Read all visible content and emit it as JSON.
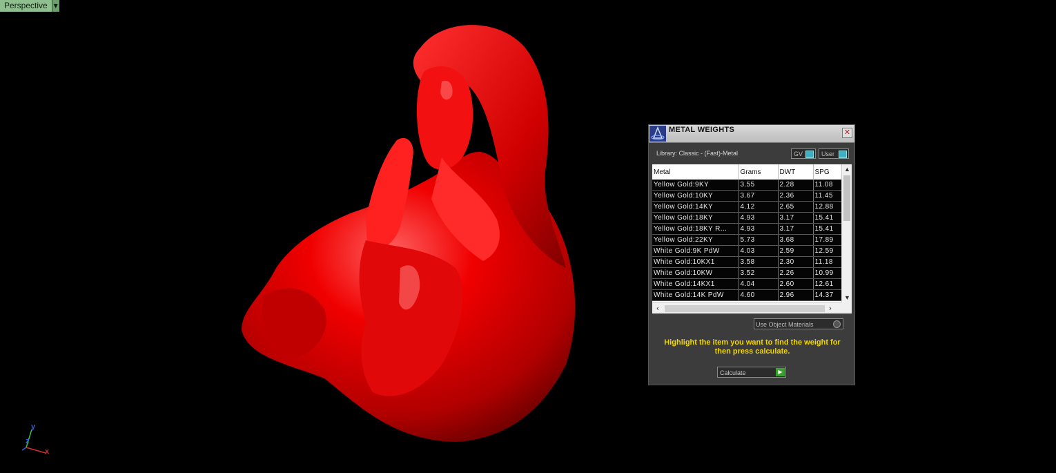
{
  "viewport": {
    "label": "Perspective"
  },
  "axis": {
    "y": "y",
    "z": "z",
    "x": "x"
  },
  "panel": {
    "title": "METAL WEIGHTS",
    "library": "Library: Classic - (Fast)-Metal",
    "toggles": {
      "gv": "GV",
      "user": "User"
    },
    "columns": [
      "Metal",
      "Grams",
      "DWT",
      "SPG"
    ],
    "rows": [
      [
        "Yellow Gold:9KY",
        "3.55",
        "2.28",
        "11.08"
      ],
      [
        "Yellow Gold:10KY",
        "3.67",
        "2.36",
        "11.45"
      ],
      [
        "Yellow Gold:14KY",
        "4.12",
        "2.65",
        "12.88"
      ],
      [
        "Yellow Gold:18KY",
        "4.93",
        "3.17",
        "15.41"
      ],
      [
        "Yellow Gold:18KY R...",
        "4.93",
        "3.17",
        "15.41"
      ],
      [
        "Yellow Gold:22KY",
        "5.73",
        "3.68",
        "17.89"
      ],
      [
        "White Gold:9K PdW",
        "4.03",
        "2.59",
        "12.59"
      ],
      [
        "White Gold:10KX1",
        "3.58",
        "2.30",
        "11.18"
      ],
      [
        "White Gold:10KW",
        "3.52",
        "2.26",
        "10.99"
      ],
      [
        "White Gold:14KX1",
        "4.04",
        "2.60",
        "12.61"
      ],
      [
        "White Gold:14K PdW",
        "4.60",
        "2.96",
        "14.37"
      ]
    ],
    "use_object_materials": "Use Object Materials",
    "hint": "Highlight the item you want to find the weight for then press calculate.",
    "calculate": "Calculate"
  },
  "colors": {
    "model": "#e60000",
    "hint": "#f2d600",
    "viewport_label": "#8fbf8f"
  }
}
